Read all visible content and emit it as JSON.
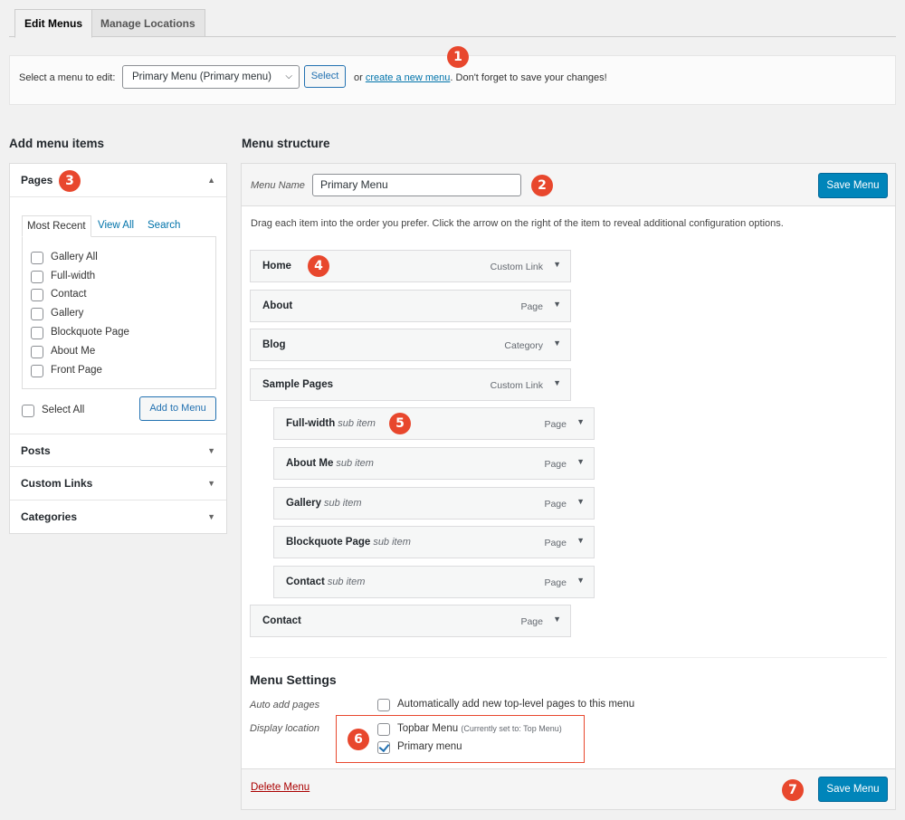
{
  "tabs": {
    "edit": "Edit Menus",
    "manage": "Manage Locations"
  },
  "manage_bar": {
    "label": "Select a menu to edit:",
    "selected_menu": "Primary Menu (Primary menu)",
    "select_button": "Select",
    "or_text": "or",
    "create_link": "create a new menu",
    "suffix": ". Don't forget to save your changes!"
  },
  "badges": [
    "1",
    "2",
    "3",
    "4",
    "5",
    "6",
    "7"
  ],
  "add_items": {
    "heading": "Add menu items",
    "pages_title": "Pages",
    "inner_tabs": [
      "Most Recent",
      "View All",
      "Search"
    ],
    "pages": [
      "Gallery All",
      "Full-width",
      "Contact",
      "Gallery",
      "Blockquote Page",
      "About Me",
      "Front Page"
    ],
    "select_all": "Select All",
    "add_button": "Add to Menu",
    "sections": [
      "Posts",
      "Custom Links",
      "Categories"
    ]
  },
  "structure": {
    "heading": "Menu structure",
    "name_label": "Menu Name",
    "name_value": "Primary Menu",
    "save_button": "Save Menu",
    "instructions": "Drag each item into the order you prefer. Click the arrow on the right of the item to reveal additional configuration options.",
    "items": [
      {
        "title": "Home",
        "type": "Custom Link",
        "sub": ""
      },
      {
        "title": "About",
        "type": "Page",
        "sub": ""
      },
      {
        "title": "Blog",
        "type": "Category",
        "sub": ""
      },
      {
        "title": "Sample Pages",
        "type": "Custom Link",
        "sub": ""
      },
      {
        "title": "Full-width",
        "type": "Page",
        "sub": "sub item"
      },
      {
        "title": "About Me",
        "type": "Page",
        "sub": "sub item"
      },
      {
        "title": "Gallery",
        "type": "Page",
        "sub": "sub item"
      },
      {
        "title": "Blockquote Page",
        "type": "Page",
        "sub": "sub item"
      },
      {
        "title": "Contact",
        "type": "Page",
        "sub": "sub item"
      },
      {
        "title": "Contact",
        "type": "Page",
        "sub": ""
      }
    ],
    "settings": {
      "heading": "Menu Settings",
      "auto_add_label": "Auto add pages",
      "auto_add_text": "Automatically add new top-level pages to this menu",
      "display_label": "Display location",
      "topbar": "Topbar Menu",
      "topbar_note": "(Currently set to: Top Menu)",
      "primary": "Primary menu"
    },
    "delete_link": "Delete Menu"
  },
  "colors": {
    "accent": "#0085ba",
    "badge": "#e8472d",
    "link": "#0073aa",
    "delete": "#a00"
  }
}
